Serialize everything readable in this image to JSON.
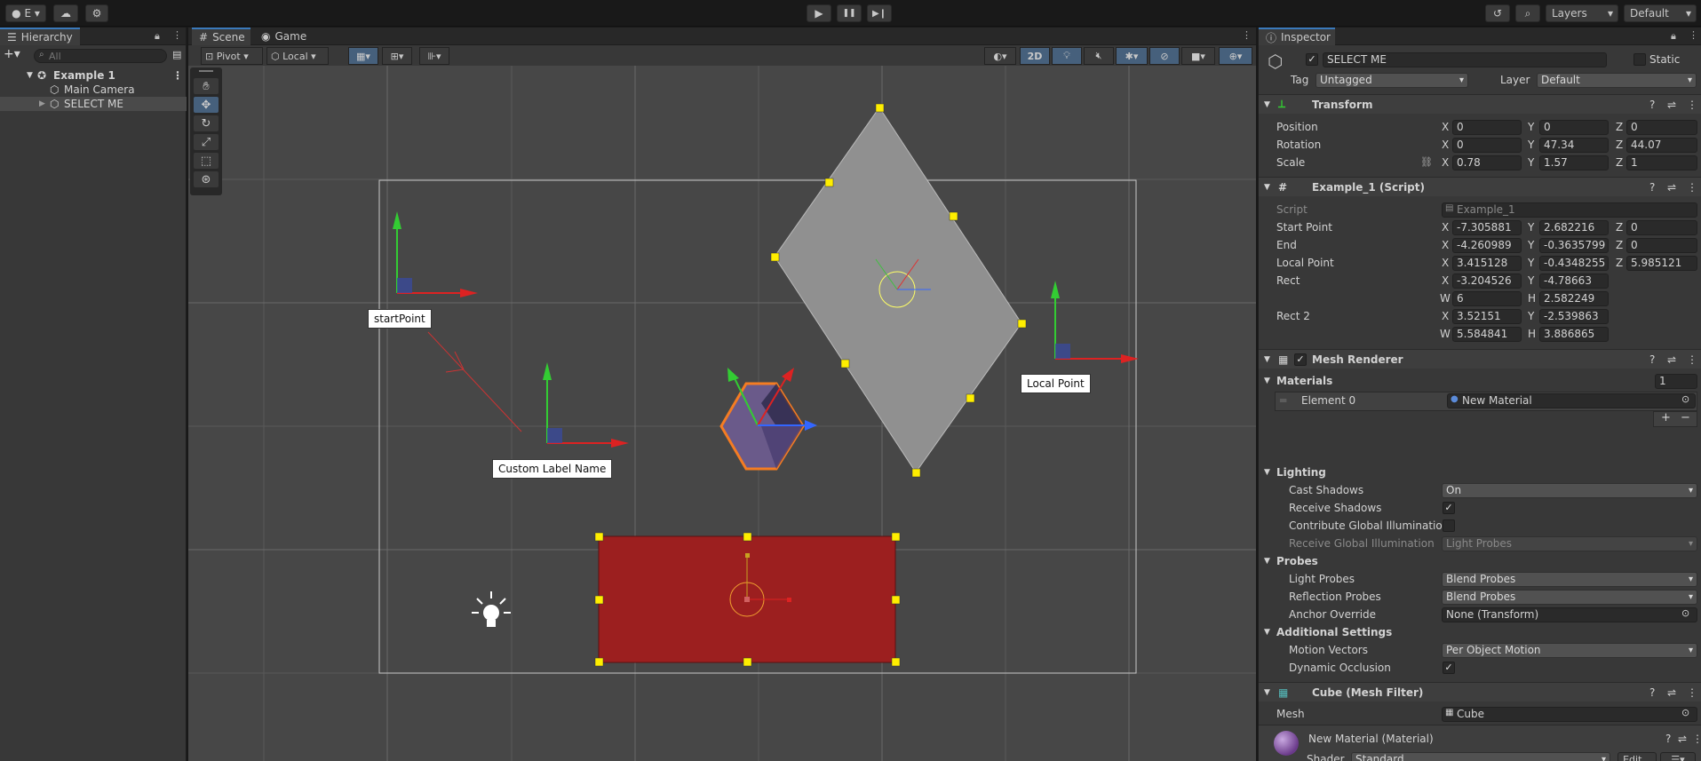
{
  "toolbar": {
    "account": "E",
    "play": "▶",
    "pause": "❚❚",
    "step": "▶❙",
    "layers": "Layers",
    "layout": "Default"
  },
  "hierarchy": {
    "title": "Hierarchy",
    "search_placeholder": "All",
    "items": [
      {
        "label": "Example 1"
      },
      {
        "label": "Main Camera"
      },
      {
        "label": "SELECT ME"
      }
    ]
  },
  "scene": {
    "tabs": [
      "Scene",
      "Game"
    ],
    "pivot": "Pivot",
    "local": "Local",
    "mode2d": "2D",
    "labels": {
      "start": "startPoint",
      "custom": "Custom Label Name",
      "local": "Local Point"
    }
  },
  "inspector": {
    "title": "Inspector",
    "object_name": "SELECT ME",
    "static": "Static",
    "tag_label": "Tag",
    "tag_value": "Untagged",
    "layer_label": "Layer",
    "layer_value": "Default",
    "transform": {
      "title": "Transform",
      "position": {
        "label": "Position",
        "x": "0",
        "y": "0",
        "z": "0"
      },
      "rotation": {
        "label": "Rotation",
        "x": "0",
        "y": "47.34",
        "z": "44.07"
      },
      "scale": {
        "label": "Scale",
        "x": "0.78",
        "y": "1.57",
        "z": "1"
      }
    },
    "script": {
      "title": "Example_1 (Script)",
      "script_label": "Script",
      "script_value": "Example_1",
      "start": {
        "label": "Start Point",
        "x": "-7.305881",
        "y": "2.682216",
        "z": "0"
      },
      "end": {
        "label": "End",
        "x": "-4.260989",
        "y": "-0.3635799",
        "z": "0"
      },
      "local": {
        "label": "Local Point",
        "x": "3.415128",
        "y": "-0.4348255",
        "z": "5.985121"
      },
      "rect": {
        "label": "Rect",
        "x": "-3.204526",
        "y": "-4.78663",
        "w": "6",
        "h": "2.582249"
      },
      "rect2": {
        "label": "Rect 2",
        "x": "3.52151",
        "y": "-2.539863",
        "w": "5.584841",
        "h": "3.886865"
      }
    },
    "mesh_renderer": {
      "title": "Mesh Renderer",
      "materials": "Materials",
      "materials_count": "1",
      "element0": "Element 0",
      "element0_value": "New Material",
      "lighting": "Lighting",
      "cast_shadows": "Cast Shadows",
      "cast_shadows_value": "On",
      "receive_shadows": "Receive Shadows",
      "contribute_gi": "Contribute Global Illumination",
      "receive_gi": "Receive Global Illumination",
      "receive_gi_value": "Light Probes",
      "probes": "Probes",
      "light_probes": "Light Probes",
      "light_probes_value": "Blend Probes",
      "reflection_probes": "Reflection Probes",
      "reflection_probes_value": "Blend Probes",
      "anchor_override": "Anchor Override",
      "anchor_override_value": "None (Transform)",
      "additional": "Additional Settings",
      "motion_vectors": "Motion Vectors",
      "motion_vectors_value": "Per Object Motion",
      "dynamic_occlusion": "Dynamic Occlusion"
    },
    "mesh_filter": {
      "title": "Cube (Mesh Filter)",
      "mesh_label": "Mesh",
      "mesh_value": "Cube"
    },
    "material": {
      "title": "New Material (Material)",
      "shader_label": "Shader",
      "shader_value": "Standard",
      "edit": "Edit..."
    },
    "labels": {
      "x": "X",
      "y": "Y",
      "z": "Z",
      "w": "W",
      "h": "H"
    }
  },
  "colors": {
    "accent": "#3a79bb",
    "selection": "#f57c22",
    "rect_fill": "#9c1f1f",
    "handle": "#ffee00"
  }
}
